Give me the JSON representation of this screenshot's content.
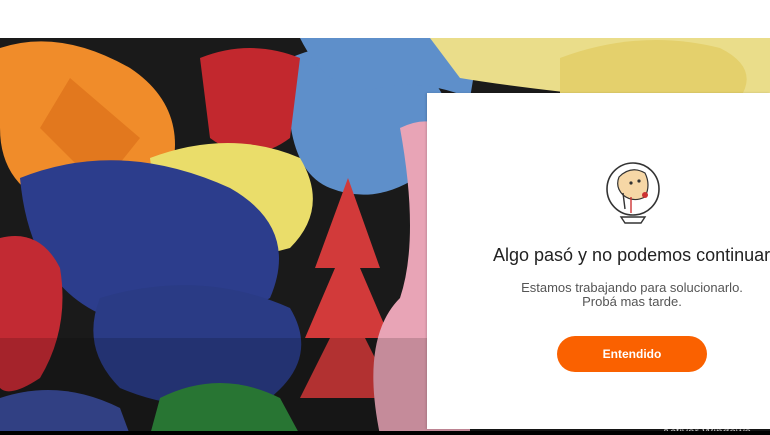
{
  "dialog": {
    "title": "Algo pasó y no podemos continuar",
    "message_line1": "Estamos trabajando para solucionarlo.",
    "message_line2": "Probá mas tarde.",
    "button_label": "Entendido",
    "button_color": "#fa6100"
  },
  "watermark": {
    "text": "Activar Windows"
  },
  "illustration": {
    "icon": "hamster-wheel-icon"
  }
}
